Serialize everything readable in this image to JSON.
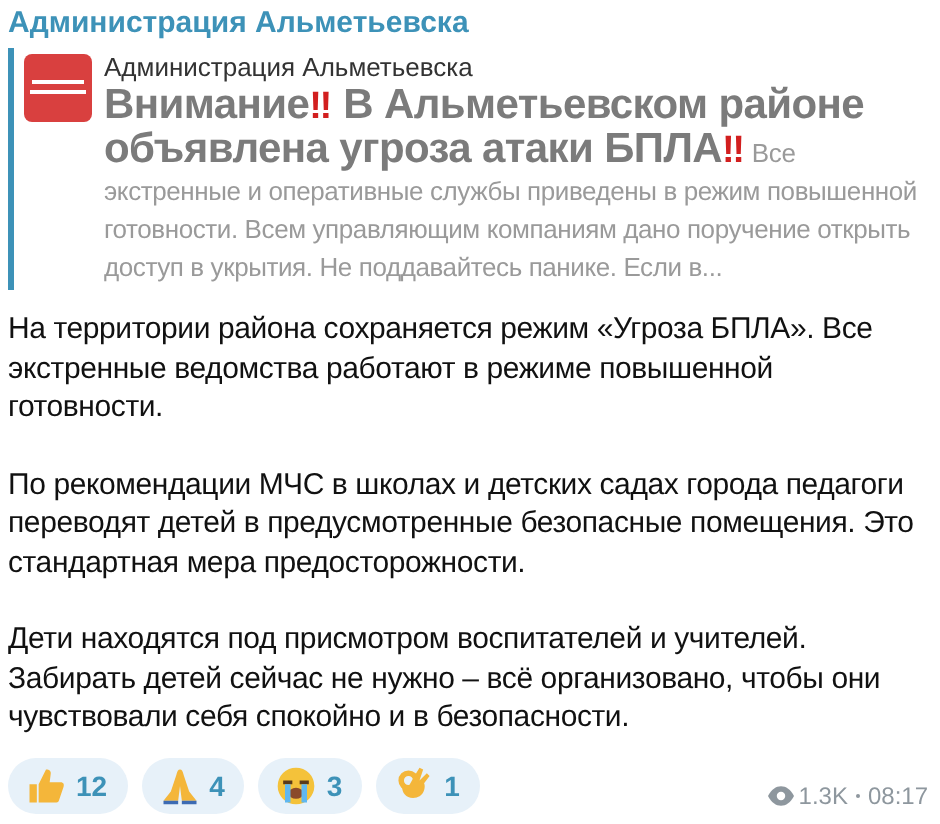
{
  "message": {
    "sender": "Администрация Альметьевска",
    "reply": {
      "author": "Администрация Альметьевска",
      "preview": [
        {
          "kind": "title",
          "text": "Внимание"
        },
        {
          "kind": "alert",
          "text": "‼"
        },
        {
          "kind": "title",
          "text": " В Альметьевском районе объявлена угроза атаки БПЛА"
        },
        {
          "kind": "alert",
          "text": "‼"
        },
        {
          "kind": "body",
          "text": " Все экстренные и оперативные службы приведены в режим повышенной готовности. Всем управляющим компаниям дано поручение открыть доступ в укрытия.  Не поддавайтесь панике. Если в..."
        }
      ]
    },
    "paragraphs": [
      "На территории района сохраняется режим «Угроза БПЛА». Все экстренные ведомства работают в режиме повышенной готовности.",
      "По рекомендации МЧС в школах и детских садах города педагоги переводят детей в предусмотренные безопасные помещения. Это стандартная мера предосторожности.",
      "Дети находятся под присмотром воспитателей и учителей. Забирать детей сейчас не нужно – всё организовано, чтобы они чувствовали себя спокойно и в безопасности."
    ],
    "reactions": [
      {
        "kind": "thumbs",
        "count": "12"
      },
      {
        "kind": "pray",
        "count": "4"
      },
      {
        "kind": "cry",
        "count": "3"
      },
      {
        "kind": "ok",
        "count": "1"
      }
    ],
    "views": "1.3K",
    "time": "08:17"
  }
}
